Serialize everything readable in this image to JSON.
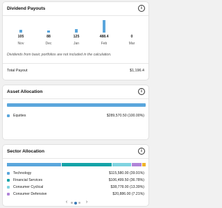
{
  "dividend_payouts": {
    "title": "Dividend Payouts",
    "info_icon": "info-icon",
    "months": [
      {
        "label": "Nov",
        "value": "105",
        "amount": 105
      },
      {
        "label": "Dec",
        "value": "88",
        "amount": 88
      },
      {
        "label": "Jan",
        "value": "125",
        "amount": 125
      },
      {
        "label": "Feb",
        "value": "488.4",
        "amount": 488.4
      },
      {
        "label": "Mar",
        "value": "0",
        "amount": 0
      }
    ],
    "note": "Dividends from basic portfolios are not included in the calculation.",
    "total_label": "Total Payout",
    "total_value": "$1,196.4"
  },
  "asset_allocation": {
    "title": "Asset Allocation",
    "items": [
      {
        "label": "Equities",
        "value": "$289,570.50 (100.00%)",
        "color": "#5aa6dc",
        "share": 100.0
      }
    ]
  },
  "sector_allocation": {
    "title": "Sector Allocation",
    "segments": [
      {
        "label": "Technology",
        "value": "$115,580.00 (39.91%)",
        "color": "#5aa6dc",
        "share": 39.91
      },
      {
        "label": "Financial Services",
        "value": "$106,499.50 (36.78%)",
        "color": "#14a3a8",
        "share": 36.78
      },
      {
        "label": "Consumer Cyclical",
        "value": "$38,778.00 (13.39%)",
        "color": "#7fd3e0",
        "share": 13.39
      },
      {
        "label": "Consumer Defensive",
        "value": "$20,886.00 (7.21%)",
        "color": "#b084d8",
        "share": 7.21
      },
      {
        "label": "",
        "value": "",
        "color": "#f0b429",
        "share": 2.71
      }
    ],
    "pager": {
      "prev": "‹",
      "next": "›",
      "pages": 3,
      "active": 1
    }
  }
}
